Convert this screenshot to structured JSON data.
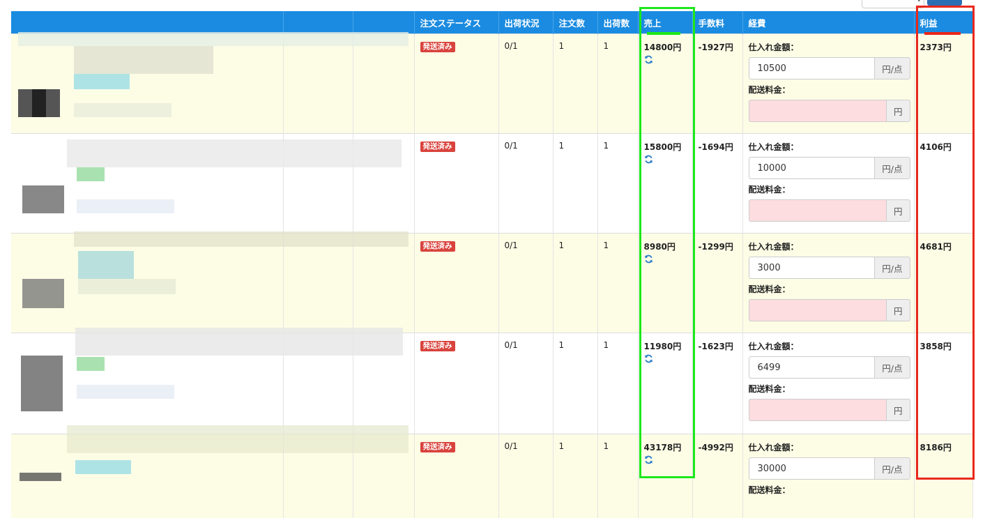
{
  "headers": {
    "product": "",
    "col2": "",
    "col3": "",
    "status": "注文ステータス",
    "shipping_state": "出荷状況",
    "order_count": "注文数",
    "shipped_count": "出荷数",
    "sales": "売上",
    "fee": "手数料",
    "expenses": "経費",
    "profit": "利益"
  },
  "labels": {
    "purchase_price": "仕入れ金額：",
    "shipping_fee": "配送料金：",
    "unit_per_item": "円/点",
    "unit_yen": "円"
  },
  "rows": [
    {
      "status": "発送済み",
      "shipping_state": "0/1",
      "order_count": "1",
      "shipped_count": "1",
      "sales": "14800円",
      "fee": "-1927円",
      "purchase_price": "10500",
      "shipping_fee": "",
      "profit": "2373円"
    },
    {
      "status": "発送済み",
      "shipping_state": "0/1",
      "order_count": "1",
      "shipped_count": "1",
      "sales": "15800円",
      "fee": "-1694円",
      "purchase_price": "10000",
      "shipping_fee": "",
      "profit": "4106円"
    },
    {
      "status": "発送済み",
      "shipping_state": "0/1",
      "order_count": "1",
      "shipped_count": "1",
      "sales": "8980円",
      "fee": "-1299円",
      "purchase_price": "3000",
      "shipping_fee": "",
      "profit": "4681円"
    },
    {
      "status": "発送済み",
      "shipping_state": "0/1",
      "order_count": "1",
      "shipped_count": "1",
      "sales": "11980円",
      "fee": "-1623円",
      "purchase_price": "6499",
      "shipping_fee": "",
      "profit": "3858円"
    },
    {
      "status": "発送済み",
      "shipping_state": "0/1",
      "order_count": "1",
      "shipped_count": "1",
      "sales": "43178円",
      "fee": "-4992円",
      "purchase_price": "30000",
      "shipping_fee": "",
      "profit": "8186円"
    }
  ],
  "colors": {
    "header_bg": "#1a8be0",
    "badge_bg": "#d9433d",
    "highlight_sales": "#1de81a",
    "highlight_profit": "#e8281c",
    "odd_row_bg": "#fdfde6",
    "pink_input_bg": "#fddddf"
  },
  "icons": {
    "refresh": "refresh-icon"
  }
}
